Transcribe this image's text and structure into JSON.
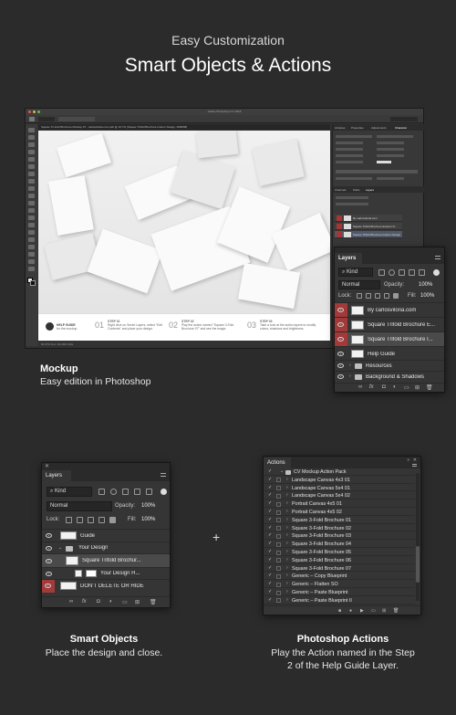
{
  "header": {
    "subtitle": "Easy Customization",
    "title": "Smart Objects & Actions"
  },
  "photoshop": {
    "window_title": "Adobe Photoshop CC 2018",
    "tab_label": "Square Tri-Fold Brochure Mockup 07 - carlosviloria.com.psb @ 16.7% (Square Trifold Brochure Interior Design, RGB/8#)",
    "status": "66.67%   Doc: 64.2M/1.09G",
    "panel_tabs": [
      "Libraries",
      "Properties",
      "Adjustments",
      "Character"
    ],
    "layer_tabs": [
      "Channels",
      "Paths",
      "Layers"
    ],
    "mini_layers": [
      "By carlosviloria.com",
      "Square Trifold Brochure Exterior D...",
      "Square Trifold Brochure Interior Design"
    ],
    "guide": {
      "brand_title": "HELP GUIDE",
      "brand_sub": "for the mockup",
      "steps": [
        {
          "num": "01",
          "title": "STEP 01",
          "text": "Right click on Smart Layers, select \"Edit Contents\" and place your design."
        },
        {
          "num": "02",
          "title": "STEP 02",
          "text": "Play the action named \"Square 3-Fold Brochure 07\" and see the magic."
        },
        {
          "num": "03",
          "title": "STEP 03",
          "text": "Take a look at the action layers to modify colors, shadows and brightness."
        }
      ]
    }
  },
  "mockup_layers": {
    "tab": "Layers",
    "kind": "Kind",
    "blend": "Normal",
    "opacity_label": "Opacity:",
    "opacity": "100%",
    "lock_label": "Lock:",
    "fill_label": "Fill:",
    "fill": "100%",
    "layers": [
      {
        "name": "By carlosviloria.com"
      },
      {
        "name": "Square Trifold Brochure E..."
      },
      {
        "name": "Square Trifold Brochure I..."
      },
      {
        "name": "Help Guide"
      },
      {
        "name": "Resources"
      },
      {
        "name": "Background & Shadows"
      }
    ]
  },
  "mockup_caption": {
    "title": "Mockup",
    "text": "Easy edition in Photoshop"
  },
  "smart_panel": {
    "tab": "Layers",
    "kind": "Kind",
    "blend": "Normal",
    "opacity_label": "Opacity:",
    "opacity": "100%",
    "lock_label": "Lock:",
    "fill_label": "Fill:",
    "fill": "100%",
    "layers": [
      {
        "name": "Guide"
      },
      {
        "name": "Your Design"
      },
      {
        "name": "Square Trifold Brochur..."
      },
      {
        "name": "Your Design H..."
      },
      {
        "name": "DON'T DELETE OR HIDE"
      }
    ]
  },
  "plus_sign": "+",
  "smart_caption": {
    "title": "Smart Objects",
    "text": "Place the design and close."
  },
  "actions_panel": {
    "tab": "Actions",
    "items": [
      "CV Mockup Action Pack",
      "Landscape Canvas 4x3 01",
      "Landscape Canvas 5x4 01",
      "Landscape Canvas 5x4 02",
      "Portrait Canvas 4x5 01",
      "Portrait Canvas 4x5 02",
      "Square 3-Fold Brochure 01",
      "Square 3-Fold Brochure 02",
      "Square 3-Fold Brochure 03",
      "Square 3-Fold Brochure 04",
      "Square 3-Fold Brochure 05",
      "Square 3-Fold Brochure 06",
      "Square 3-Fold Brochure 07",
      "Generic – Copy Blueprint",
      "Generic – Flatten SO",
      "Generic – Paste Blueprint",
      "Generic – Paste Blueprint II"
    ]
  },
  "actions_caption": {
    "title": "Photoshop Actions",
    "lines": [
      "Play the Action named in the Step",
      "2 of the Help Guide Layer."
    ]
  },
  "colors": {
    "background": "#2b2b2b",
    "panel": "#353535",
    "protected_layer": "#a33a3a"
  }
}
